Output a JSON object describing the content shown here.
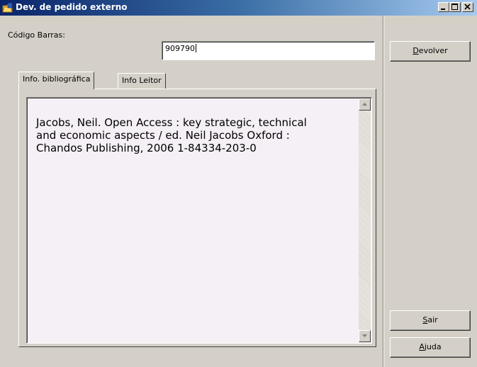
{
  "window": {
    "title": "Dev. de pedido externo",
    "app_icon": "folder-book-icon",
    "controls": [
      "minimize-icon",
      "maximize-icon",
      "close-icon"
    ]
  },
  "form": {
    "barcode_label": "Código Barras:",
    "barcode_value": "909790"
  },
  "tabs": [
    {
      "label": "Info. bibliográfica",
      "active": true
    },
    {
      "label": "Info Leitor",
      "active": false
    }
  ],
  "bibliographic_text": "Jacobs, Neil. Open Access : key strategic, technical\nand economic aspects / ed. Neil Jacobs Oxford :\nChandos Publishing, 2006 1-84334-203-0",
  "buttons": {
    "devolver": {
      "mnemonic": "D",
      "rest": "evolver"
    },
    "sair": {
      "mnemonic": "S",
      "rest": "air"
    },
    "ajuda": {
      "mnemonic": "A",
      "rest": "juda"
    }
  },
  "colors": {
    "titlebar_start": "#0a246a",
    "titlebar_end": "#a6caf0",
    "face": "#d4d0c8",
    "memo_bg": "#f5f0f5"
  }
}
